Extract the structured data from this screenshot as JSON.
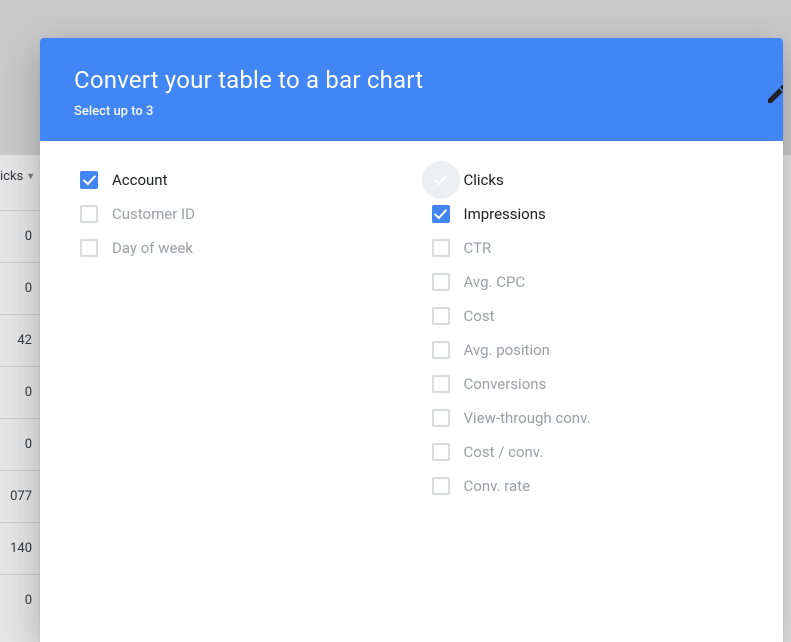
{
  "background": {
    "column_header": "icks",
    "cells": [
      "0",
      "0",
      "42",
      "0",
      "0",
      "077",
      "140",
      "0"
    ]
  },
  "modal": {
    "title": "Convert your table to a bar chart",
    "subtitle": "Select up to 3",
    "columns": {
      "left": [
        {
          "key": "account",
          "label": "Account",
          "checked": true,
          "disabled": false
        },
        {
          "key": "customer-id",
          "label": "Customer ID",
          "checked": false,
          "disabled": true
        },
        {
          "key": "day-of-week",
          "label": "Day of week",
          "checked": false,
          "disabled": true
        }
      ],
      "right": [
        {
          "key": "clicks",
          "label": "Clicks",
          "checked": true,
          "disabled": false,
          "focus": true
        },
        {
          "key": "impressions",
          "label": "Impressions",
          "checked": true,
          "disabled": false
        },
        {
          "key": "ctr",
          "label": "CTR",
          "checked": false,
          "disabled": true
        },
        {
          "key": "avg-cpc",
          "label": "Avg. CPC",
          "checked": false,
          "disabled": true
        },
        {
          "key": "cost",
          "label": "Cost",
          "checked": false,
          "disabled": true
        },
        {
          "key": "avg-position",
          "label": "Avg. position",
          "checked": false,
          "disabled": true
        },
        {
          "key": "conversions",
          "label": "Conversions",
          "checked": false,
          "disabled": true
        },
        {
          "key": "view-through-conv",
          "label": "View-through conv.",
          "checked": false,
          "disabled": true
        },
        {
          "key": "cost-per-conv",
          "label": "Cost / conv.",
          "checked": false,
          "disabled": true
        },
        {
          "key": "conv-rate",
          "label": "Conv. rate",
          "checked": false,
          "disabled": true
        }
      ]
    }
  }
}
